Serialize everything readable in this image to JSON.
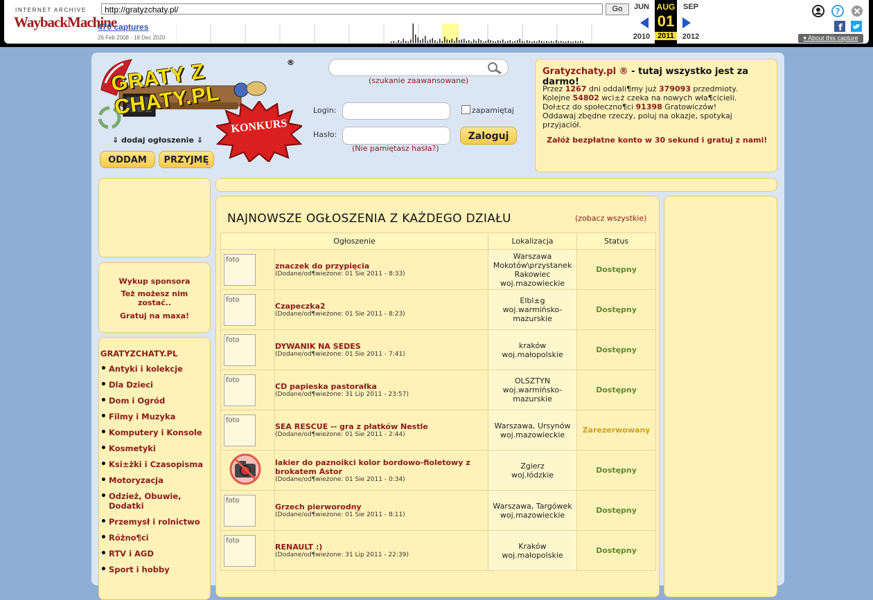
{
  "wayback": {
    "logo_top": "INTERNET ARCHIVE",
    "logo_main": "WaybackMachine",
    "url": "http://gratyzchaty.pl/",
    "go_label": "Go",
    "captures": "470 captures",
    "date_range": "26 Feb 2008 - 18 Dec 2020",
    "prev_month": "JUN",
    "cur_month": "AUG",
    "next_month": "SEP",
    "cur_day": "01",
    "prev_year": "2010",
    "cur_year": "2011",
    "next_year": "2012",
    "about": "About this capture"
  },
  "header": {
    "logo_text": "GRATY Z CHATY.PL",
    "logo_reg": "®",
    "konkurs": "KONKURS",
    "dodaj": "⇓ dodaj ogłoszenie ⇓",
    "oddam": "ODDAM",
    "przyjme": "PRZYJMĘ",
    "search_advanced": "(szukanie zaawansowane)",
    "login_label": "Login:",
    "password_label": "Hasło:",
    "remember": "zapamiętaj",
    "login_button": "Zaloguj",
    "forgot": "(Nie pamiętasz hasła?)"
  },
  "info": {
    "title_brand": "Gratyzchaty.pl ®",
    "title_rest": " - tutaj wszystko jest za darmo!",
    "line1_a": "Przez ",
    "line1_days": "1267",
    "line1_b": " dni oddali¶my już ",
    "line1_items": "379093",
    "line1_c": " przedmioty.",
    "line2_a": "Kolejne ",
    "line2_wait": "54802",
    "line2_b": " wci±ż czeka na nowych wła¶cicieli.",
    "line3_a": "Doł±cz do społeczno¶ci ",
    "line3_users": "91398",
    "line3_b": " Gratowiczów!",
    "line4": "Oddawaj zbędne rzeczy, poluj na okazje, spotykaj przyjaciół.",
    "cta_link": "Załóż bezpłatne konto",
    "cta_rest": " w 30 sekund i gratuj z nami!"
  },
  "sponsor": {
    "line1": "Wykup sponsora",
    "line2": "Też możesz nim zostać..",
    "line3": "Gratuj na maxa!"
  },
  "categories": {
    "title": "GRATYZCHATY.PL",
    "items": [
      "Antyki i kolekcje",
      "Dla Dzieci",
      "Dom i Ogród",
      "Filmy i Muzyka",
      "Komputery i Konsole",
      "Kosmetyki",
      "Ksi±żki i Czasopisma",
      "Motoryzacja",
      "Odzież, Obuwie, Dodatki",
      "Przemysł i rolnictwo",
      "Różno¶ci",
      "RTV i AGD",
      "Sport i hobby"
    ]
  },
  "main": {
    "title": "NAJNOWSZE OGŁOSZENIA Z KAŻDEGO DZIAŁU",
    "see_all": "(zobacz wszystkie)",
    "columns": [
      "Ogłoszenie",
      "Lokalizacja",
      "Status"
    ],
    "photo_alt": "foto",
    "rows": [
      {
        "title": "znaczek do przypięcia",
        "date": "(Dodane/od¶wieżone: 01 Sie 2011 - 8:33)",
        "loc1": "Warszawa",
        "loc2": "Mokotów\\przystanek Rakowiec",
        "loc3": "woj.mazowieckie",
        "status": "Dostępny"
      },
      {
        "title": "Czapeczka2",
        "date": "(Dodane/od¶wieżone: 01 Sie 2011 - 8:23)",
        "loc1": "Elbl±g",
        "loc2": "woj.warmińsko-mazurskie",
        "loc3": "",
        "status": "Dostępny"
      },
      {
        "title": "DYWANIK NA SEDES",
        "date": "(Dodane/od¶wieżone: 01 Sie 2011 - 7:41)",
        "loc1": "kraków",
        "loc2": "woj.małopolskie",
        "loc3": "",
        "status": "Dostępny"
      },
      {
        "title": "CD papieska pastorałka",
        "date": "(Dodane/od¶wieżone: 31 Lip 2011 - 23:57)",
        "loc1": "OLSZTYN",
        "loc2": "woj.warmińsko-mazurskie",
        "loc3": "",
        "status": "Dostępny"
      },
      {
        "title": "SEA RESCUE -- gra z płatków Nestle",
        "date": "(Dodane/od¶wieżone: 01 Sie 2011 - 2:44)",
        "loc1": "Warszawa, Ursynów",
        "loc2": "woj.mazowieckie",
        "loc3": "",
        "status": "Zarezerwowany"
      },
      {
        "title": "lakier do paznoikci kolor bordowo-fioletowy z brokatem Astor",
        "date": "(Dodane/od¶wieżone: 01 Sie 2011 - 0:34)",
        "loc1": "Zgierz",
        "loc2": "woj.łódzkie",
        "loc3": "",
        "status": "Dostępny"
      },
      {
        "title": "Grzech pierworodny",
        "date": "(Dodane/od¶wieżone: 01 Sie 2011 - 8:11)",
        "loc1": "Warszawa, Targówek",
        "loc2": "woj.mazowieckie",
        "loc3": "",
        "status": "Dostępny"
      },
      {
        "title": "RENAULT :)",
        "date": "(Dodane/od¶wieżone: 31 Lip 2011 - 22:39)",
        "loc1": "Kraków",
        "loc2": "woj.małopolskie",
        "loc3": "",
        "status": "Dostępny"
      }
    ]
  },
  "colors": {
    "background": "#8eaed6",
    "panel": "#fff2b8",
    "accent_red": "#8b1a1a",
    "available": "#5d8a32",
    "reserved": "#c9a123"
  }
}
